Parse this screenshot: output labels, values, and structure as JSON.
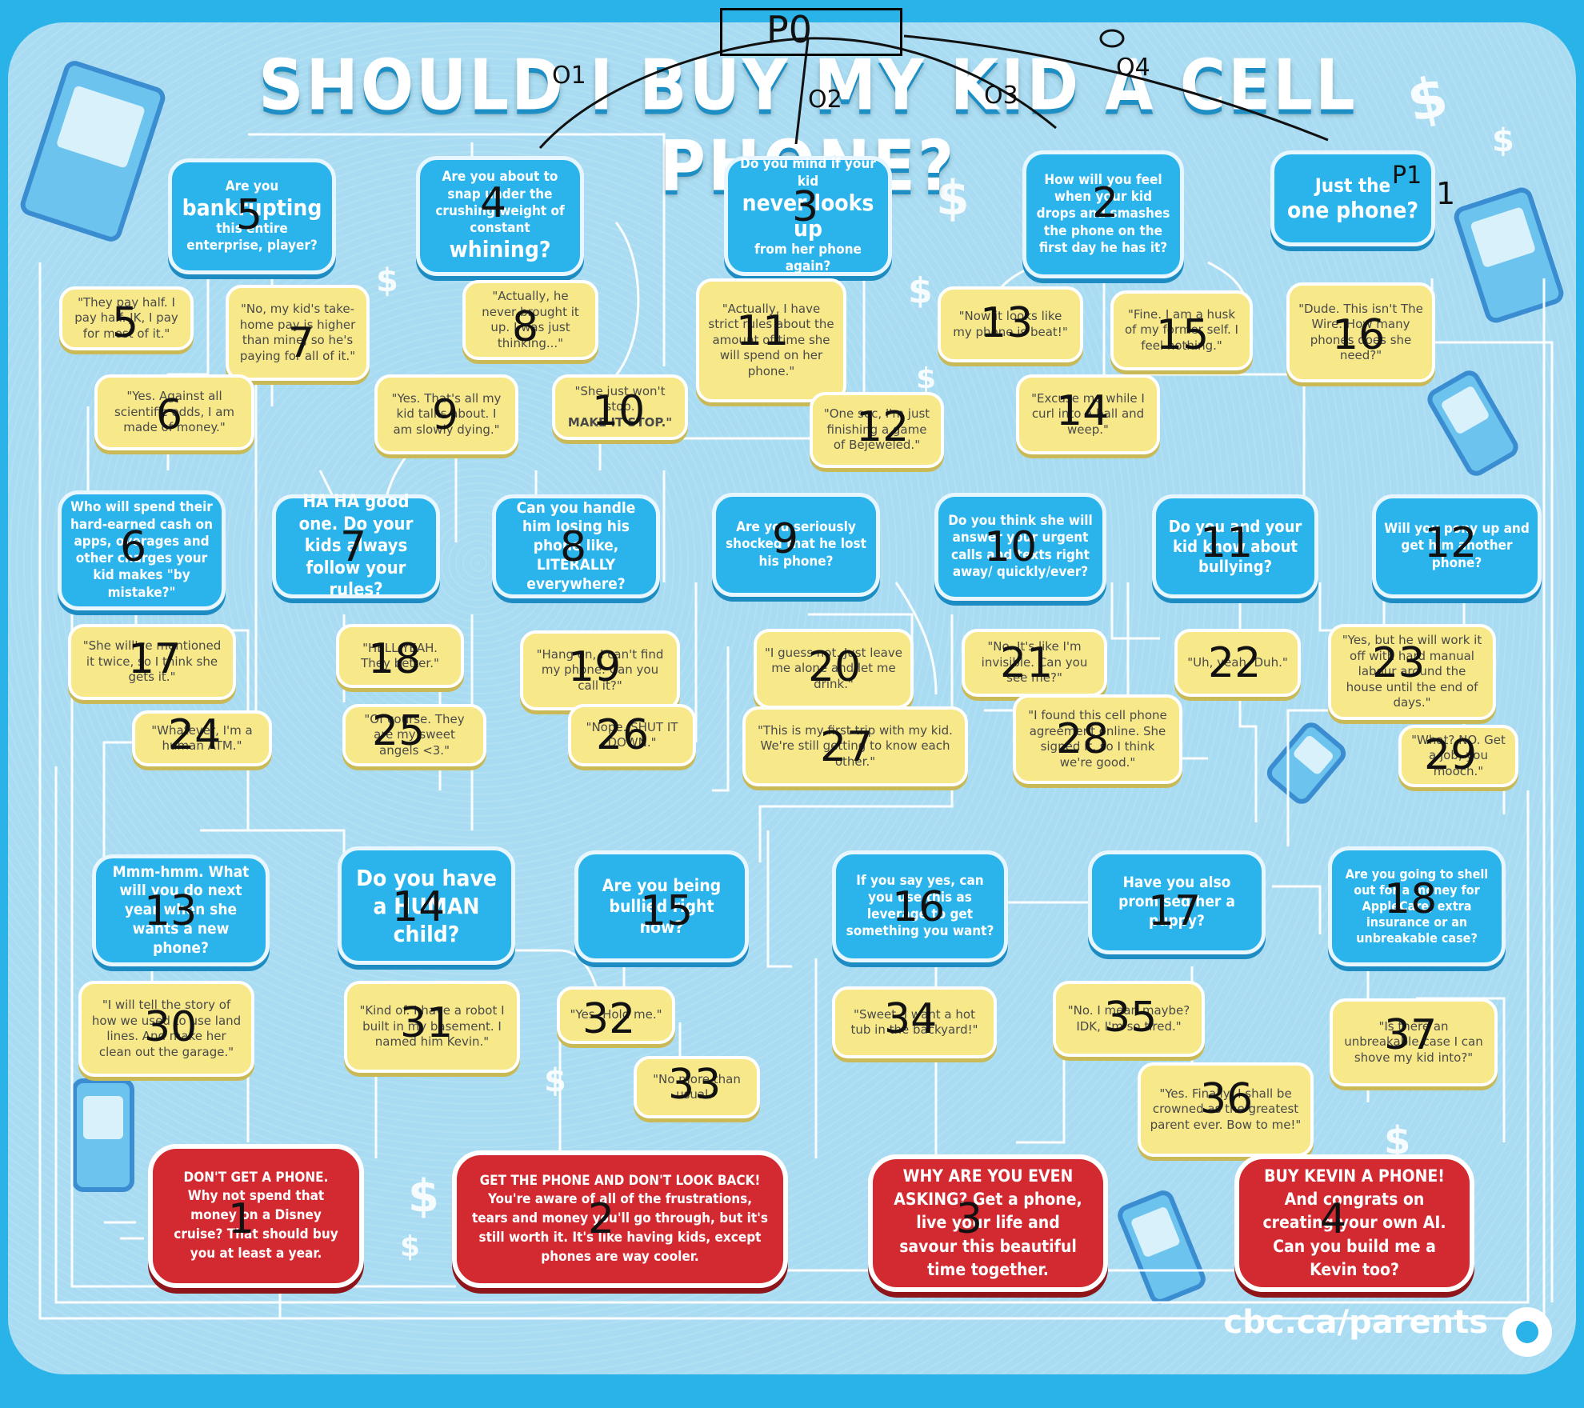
{
  "title": "SHOULD I BUY MY KID A CELL PHONE?",
  "footer": "cbc.ca/parents",
  "handwritten": {
    "p0": "P0",
    "p1": "P1",
    "o1": "O1",
    "o2": "O2",
    "o3": "O3",
    "o4": "O4"
  },
  "questions": [
    {
      "id": "q1",
      "num": "1",
      "small": "Just the",
      "big": "one phone?",
      "after": ""
    },
    {
      "id": "q2",
      "num": "2",
      "small": "How will you feel when your kid drops and smashes the phone on the first day he has it?",
      "big": "",
      "after": ""
    },
    {
      "id": "q3",
      "num": "3",
      "small": "Do you mind if your kid",
      "big": "never looks up",
      "after": "from her phone again?"
    },
    {
      "id": "q4",
      "num": "4",
      "small": "Are you about to snap under the crushing weight of constant",
      "big": "whining?",
      "after": ""
    },
    {
      "id": "q5",
      "num": "5",
      "small": "Are you",
      "big": "bankrupting",
      "after": "this entire enterprise, player?"
    },
    {
      "id": "q6",
      "num": "6",
      "small": "Who will spend their hard-earned cash on apps, overages and other charges your kid makes \"by mistake?\"",
      "big": "",
      "after": ""
    },
    {
      "id": "q7",
      "num": "7",
      "small": "HA HA good one. Do your kids always follow your rules?",
      "big": "",
      "after": ""
    },
    {
      "id": "q8",
      "num": "8",
      "small": "Can you handle him losing his phone like, LITERALLY everywhere?",
      "big": "",
      "after": ""
    },
    {
      "id": "q9",
      "num": "9",
      "small": "Are you seriously shocked that he lost his phone?",
      "big": "",
      "after": ""
    },
    {
      "id": "q10",
      "num": "10",
      "small": "Do you think she will answer your urgent calls and texts right away/ quickly/ever?",
      "big": "",
      "after": ""
    },
    {
      "id": "q11",
      "num": "11",
      "small": "Do you and your kid know about bullying?",
      "big": "",
      "after": ""
    },
    {
      "id": "q12",
      "num": "12",
      "small": "Will you pony up and get him another phone?",
      "big": "",
      "after": ""
    },
    {
      "id": "q13",
      "num": "13",
      "small": "Mmm-hmm. What will you do next year when she wants a new phone?",
      "big": "",
      "after": ""
    },
    {
      "id": "q14",
      "num": "14",
      "small": "Do you have a HUMAN child?",
      "big": "",
      "after": ""
    },
    {
      "id": "q15",
      "num": "15",
      "small": "Are you being bullied right now?",
      "big": "",
      "after": ""
    },
    {
      "id": "q16",
      "num": "16",
      "small": "If you say yes, can you use this as leverage to get something you want?",
      "big": "",
      "after": ""
    },
    {
      "id": "q17",
      "num": "17",
      "small": "Have you also promised her a puppy?",
      "big": "",
      "after": ""
    },
    {
      "id": "q18",
      "num": "18",
      "small": "Are you going to shell out for a money for AppleCare, extra insurance or an unbreakable case?",
      "big": "",
      "after": ""
    }
  ],
  "answers": [
    {
      "id": "a5",
      "num": "5",
      "text": "\"They pay half. I pay half. JK, I pay for most of it.\""
    },
    {
      "id": "a7",
      "num": "7",
      "text": "\"No, my kid's take-home pay is higher than mine, so he's paying for all of it.\""
    },
    {
      "id": "a6",
      "num": "6",
      "text": "\"Yes. Against all scientific odds, I am made of money.\""
    },
    {
      "id": "a8",
      "num": "8",
      "text": "\"Actually, he never brought it up. I was just thinking...\""
    },
    {
      "id": "a9",
      "num": "9",
      "text": "\"Yes. That's all my kid talks about. I am slowly dying.\""
    },
    {
      "id": "a10",
      "num": "10",
      "text": "\"She just won't stop.",
      "bold": "MAKE IT STOP.\""
    },
    {
      "id": "a11",
      "num": "11",
      "text": "\"Actually, I have strict rules about the amount of time she will spend on her phone.\""
    },
    {
      "id": "a12",
      "num": "12",
      "text": "\"One sec, I'm just finishing a game of Bejeweled.\""
    },
    {
      "id": "a13",
      "num": "13",
      "text": "\"Now it looks like my phone is beat!\""
    },
    {
      "id": "a15",
      "num": "15",
      "text": "\"Fine. I am a husk of my former self. I feel nothing.\""
    },
    {
      "id": "a14",
      "num": "14",
      "text": "\"Excuse me while I curl into a ball and weep.\""
    },
    {
      "id": "a16",
      "num": "16",
      "text": "\"Dude. This isn't The Wire. How many phones does she need?\""
    },
    {
      "id": "a17",
      "num": "17",
      "text": "\"She will've mentioned it twice, so I think she gets it.\""
    },
    {
      "id": "a18",
      "num": "18",
      "text": "\"HELL YEAH. They better.\""
    },
    {
      "id": "a19",
      "num": "19",
      "text": "\"Hang on, I can't find my phone. Can you call it?\""
    },
    {
      "id": "a20",
      "num": "20",
      "text": "\"I guess not. Just leave me alone and let me drink.\""
    },
    {
      "id": "a21",
      "num": "21",
      "text": "\"No. It's like I'm invisible. Can you see me?\""
    },
    {
      "id": "a22",
      "num": "22",
      "text": "\"Uh, yeah. Duh.\""
    },
    {
      "id": "a23",
      "num": "23",
      "text": "\"Yes, but he will work it off with hard manual labour around the house until the end of days.\""
    },
    {
      "id": "a24",
      "num": "24",
      "text": "\"Whatever, I'm a human ATM.\""
    },
    {
      "id": "a25",
      "num": "25",
      "text": "\"Of course. They are my sweet angels <3.\""
    },
    {
      "id": "a26",
      "num": "26",
      "text": "\"Nope. SHUT IT DOWN.\""
    },
    {
      "id": "a27",
      "num": "27",
      "text": "\"This is my first trip with my kid. We're still getting to know each other.\""
    },
    {
      "id": "a28",
      "num": "28",
      "text": "\"I found this cell phone agreement online. She signed it, so I think we're good.\""
    },
    {
      "id": "a29",
      "num": "29",
      "text": "\"What? NO. Get a job, you mooch.\""
    },
    {
      "id": "a30",
      "num": "30",
      "text": "\"I will tell the story of how we used to use land lines. And make her clean out the garage.\""
    },
    {
      "id": "a31",
      "num": "31",
      "text": "\"Kind of. I have a robot I built in my basement. I named him Kevin.\""
    },
    {
      "id": "a32",
      "num": "32",
      "text": "\"Yes. Hold me.\""
    },
    {
      "id": "a33",
      "num": "33",
      "text": "\"No more than usual.\""
    },
    {
      "id": "a34",
      "num": "34",
      "text": "\"Sweet. I want a hot tub in the backyard!\""
    },
    {
      "id": "a35",
      "num": "35",
      "text": "\"No. I mean maybe? IDK, I'm so tired.\""
    },
    {
      "id": "a36",
      "num": "36",
      "text": "\"Yes. Finally, I shall be crowned as the greatest parent ever. Bow to me!\""
    },
    {
      "id": "a37",
      "num": "37",
      "text": "\"Is there an unbreakable case I can shove my kid into?\""
    }
  ],
  "endings": [
    {
      "id": "e1",
      "num": "1",
      "text": "DON'T GET A PHONE. Why not spend that money on a Disney cruise? That should buy you at least a year."
    },
    {
      "id": "e2",
      "num": "2",
      "text": "GET THE PHONE AND DON'T LOOK BACK! You're aware of all of the frustrations, tears and money you'll go through, but it's still worth it. It's like having kids, except phones are way cooler."
    },
    {
      "id": "e3",
      "num": "3",
      "text": "WHY ARE YOU EVEN ASKING? Get a phone, live your life and savour this beautiful time together."
    },
    {
      "id": "e4",
      "num": "4",
      "text": "BUY KEVIN A PHONE! And congrats on creating your own AI. Can you build me a Kevin too?"
    }
  ],
  "colors": {
    "background": "#2ab3e8",
    "board": "#a9dcf2",
    "question": "#2bb4ec",
    "answer": "#f7e889",
    "ending": "#d22a30",
    "line": "#ffffff"
  }
}
